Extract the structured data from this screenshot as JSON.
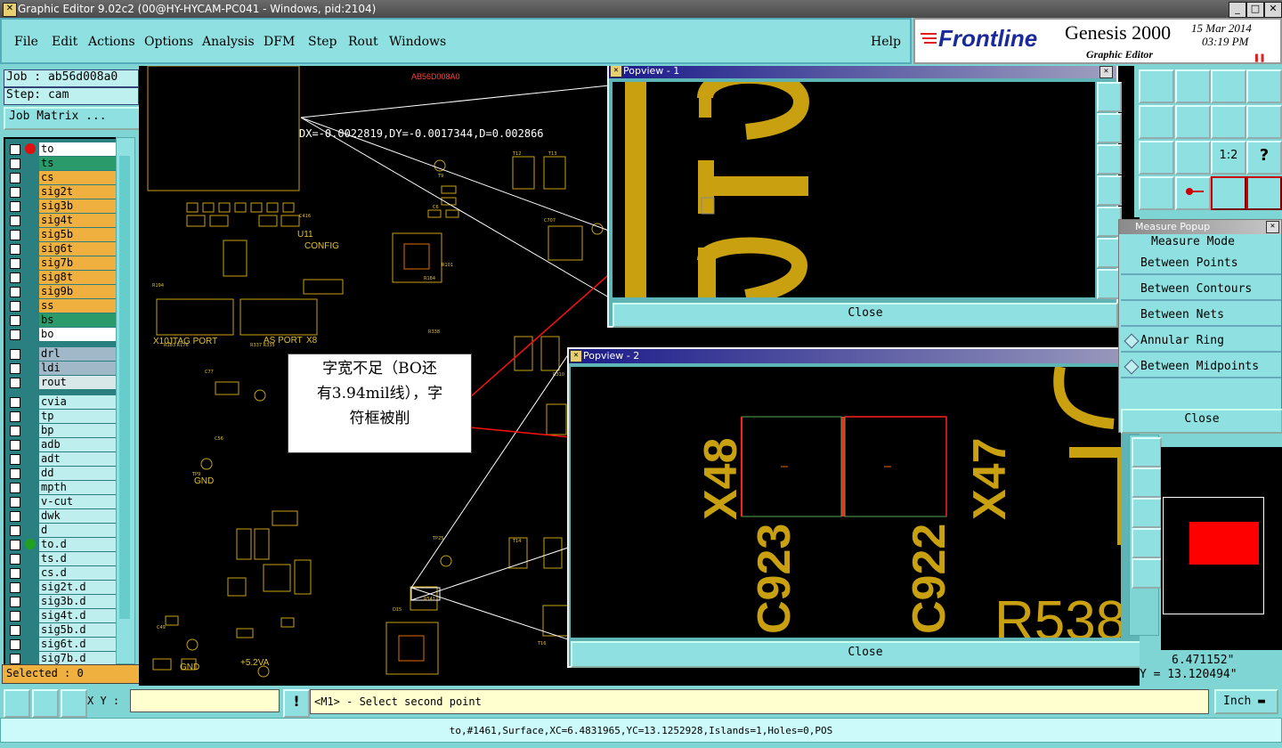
{
  "window": {
    "title": "Graphic Editor 9.02c2 (00@HY-HYCAM-PC041 - Windows, pid:2104)"
  },
  "menu": [
    "File",
    "Edit",
    "Actions",
    "Options",
    "Analysis",
    "DFM",
    "Step",
    "Rout",
    "Windows"
  ],
  "help_label": "Help",
  "brand": {
    "logo": "Frontline",
    "product": "Genesis 2000",
    "date": "15 Mar 2014",
    "time": "03:19 PM",
    "subtitle": "Graphic Editor"
  },
  "job": {
    "job_label": "Job : ab56d008a0",
    "step_label": "Step: cam",
    "matrix_button": "Job Matrix ..."
  },
  "layers_group1": [
    {
      "name": "to",
      "color": "#ffffff",
      "marker": "red"
    },
    {
      "name": "ts",
      "color": "#2a9a6a"
    },
    {
      "name": "cs",
      "color": "#f0b040"
    },
    {
      "name": "sig2t",
      "color": "#f0b040"
    },
    {
      "name": "sig3b",
      "color": "#f0b040"
    },
    {
      "name": "sig4t",
      "color": "#f0b040"
    },
    {
      "name": "sig5b",
      "color": "#f0b040"
    },
    {
      "name": "sig6t",
      "color": "#f0b040"
    },
    {
      "name": "sig7b",
      "color": "#f0b040"
    },
    {
      "name": "sig8t",
      "color": "#f0b040"
    },
    {
      "name": "sig9b",
      "color": "#f0b040"
    },
    {
      "name": "ss",
      "color": "#f0b040"
    },
    {
      "name": "bs",
      "color": "#2a9a6a"
    },
    {
      "name": "bo",
      "color": "#ffffff"
    }
  ],
  "layers_group2": [
    {
      "name": "drl",
      "color": "#a0b8c8"
    },
    {
      "name": "ldi",
      "color": "#a0b8c8"
    },
    {
      "name": "rout",
      "color": "#d8e8e8"
    }
  ],
  "layers_group3": [
    {
      "name": "cvia",
      "color": "#bfeeee"
    },
    {
      "name": "tp",
      "color": "#bfeeee"
    },
    {
      "name": "bp",
      "color": "#bfeeee"
    },
    {
      "name": "adb",
      "color": "#bfeeee"
    },
    {
      "name": "adt",
      "color": "#bfeeee"
    },
    {
      "name": "dd",
      "color": "#bfeeee"
    },
    {
      "name": "mpth",
      "color": "#bfeeee"
    },
    {
      "name": "v-cut",
      "color": "#bfeeee"
    },
    {
      "name": "dwk",
      "color": "#bfeeee"
    },
    {
      "name": "d",
      "color": "#bfeeee"
    },
    {
      "name": "to.d",
      "color": "#bfeeee",
      "marker": "green"
    },
    {
      "name": "ts.d",
      "color": "#bfeeee"
    },
    {
      "name": "cs.d",
      "color": "#bfeeee"
    },
    {
      "name": "sig2t.d",
      "color": "#bfeeee"
    },
    {
      "name": "sig3b.d",
      "color": "#bfeeee"
    },
    {
      "name": "sig4t.d",
      "color": "#bfeeee"
    },
    {
      "name": "sig5b.d",
      "color": "#bfeeee"
    },
    {
      "name": "sig6t.d",
      "color": "#bfeeee"
    },
    {
      "name": "sig7b.d",
      "color": "#bfeeee"
    }
  ],
  "selected_label": "Selected : 0",
  "canvas": {
    "measure_text": "DX=-0.0022819,DY=-0.0017344,D=0.002866",
    "board_id": "AB56D008A0",
    "labels": [
      "CONFIG",
      "JTAG PORT",
      "AS PORT",
      "GND",
      "GND",
      "+5.2VA",
      "X10",
      "X8",
      "U11",
      "U23"
    ]
  },
  "annotation": {
    "text_line1": "字宽不足（BO还",
    "text_line2": "有3.94mil线），字",
    "text_line3": "符框被削"
  },
  "popview1": {
    "title": "Popview - 1",
    "close_label": "Close",
    "glyphs": "212"
  },
  "popview2": {
    "title": "Popview - 2",
    "close_label": "Close",
    "labels": [
      "X48",
      "X47",
      "C923",
      "C922",
      "R538"
    ]
  },
  "measure_popup": {
    "title": "Measure Popup",
    "mode_label": "Measure Mode",
    "options": [
      "Between Points",
      "Between Contours",
      "Between Nets",
      "Annular Ring",
      "Between Midpoints"
    ],
    "close_label": "Close"
  },
  "coords": {
    "x": "6.471152\"",
    "y": "Y = 13.120494\""
  },
  "bottom": {
    "xy_label": "X Y :",
    "xy_value": "",
    "prompt": "<M1> - Select second point",
    "units": "Inch"
  },
  "status_text": "to,#1461,Surface,XC=6.4831965,YC=13.1252928,Islands=1,Holes=0,POS",
  "colors": {
    "panel": "#7fd4d4",
    "copper": "#c8a010",
    "highlight": "#ff0000"
  }
}
